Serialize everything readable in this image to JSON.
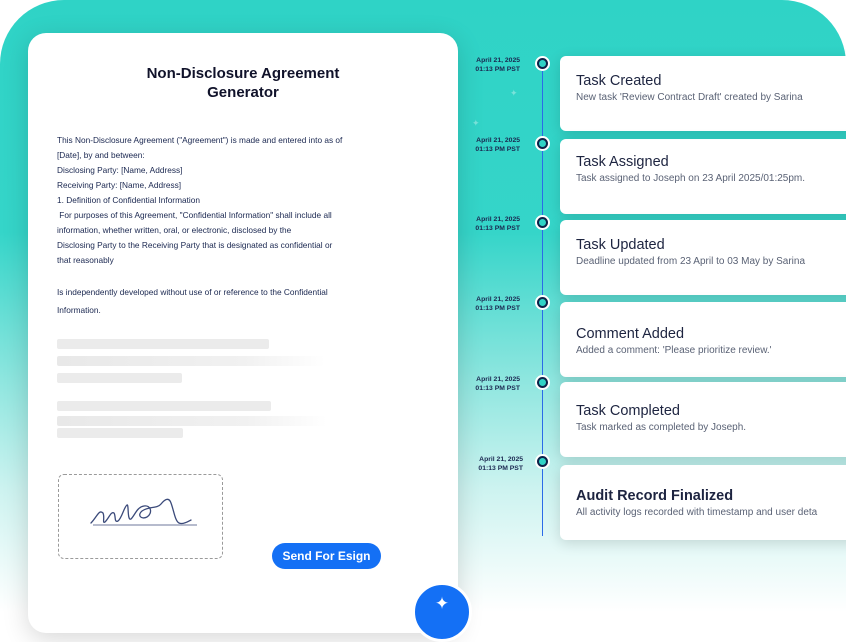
{
  "document": {
    "title_line1": "Non-Disclosure Agreement",
    "title_line2": "Generator",
    "body": [
      "This Non-Disclosure Agreement (\"Agreement\") is made and entered into as of",
      "[Date], by and between:",
      "Disclosing Party: [Name, Address]",
      "Receiving Party: [Name, Address]",
      "1. Definition of Confidential Information",
      " For purposes of this Agreement, \"Confidential Information\" shall include all",
      "information, whether written, oral, or electronic, disclosed by the",
      "Disclosing Party to the Receiving Party that is designated as confidential or",
      "that reasonably"
    ],
    "body_extra": [
      "Is independently developed without use of or reference to the Confidential",
      "Information."
    ],
    "send_button": "Send For Esign"
  },
  "timeline": [
    {
      "date": "April 21, 2025",
      "time": "01:13 PM PST",
      "title": "Task Created",
      "description": "New task 'Review Contract Draft' created by Sarina"
    },
    {
      "date": "April 21, 2025",
      "time": "01:13 PM PST",
      "title": "Task Assigned",
      "description": "Task assigned to Joseph on 23 April 2025/01:25pm."
    },
    {
      "date": "April 21, 2025",
      "time": "01:13 PM PST",
      "title": "Task Updated",
      "description": "Deadline updated from 23 April to 03 May by Sarina"
    },
    {
      "date": "April 21, 2025",
      "time": "01:13 PM PST",
      "title": "Comment Added",
      "description": "Added a comment: 'Please prioritize review.'"
    },
    {
      "date": "April 21, 2025",
      "time": "01:13 PM PST",
      "title": "Task Completed",
      "description": "Task marked as completed by Joseph."
    },
    {
      "date": "April 21, 2025",
      "time": "01:13 PM PST",
      "title": "Audit Record Finalized",
      "description": "All activity logs recorded with timestamp and user deta"
    }
  ],
  "colors": {
    "accent": "#1470f5",
    "teal": "#2fd3c6",
    "text_dark": "#1d2440"
  },
  "icons": {
    "fab": "sparkle-icon"
  }
}
